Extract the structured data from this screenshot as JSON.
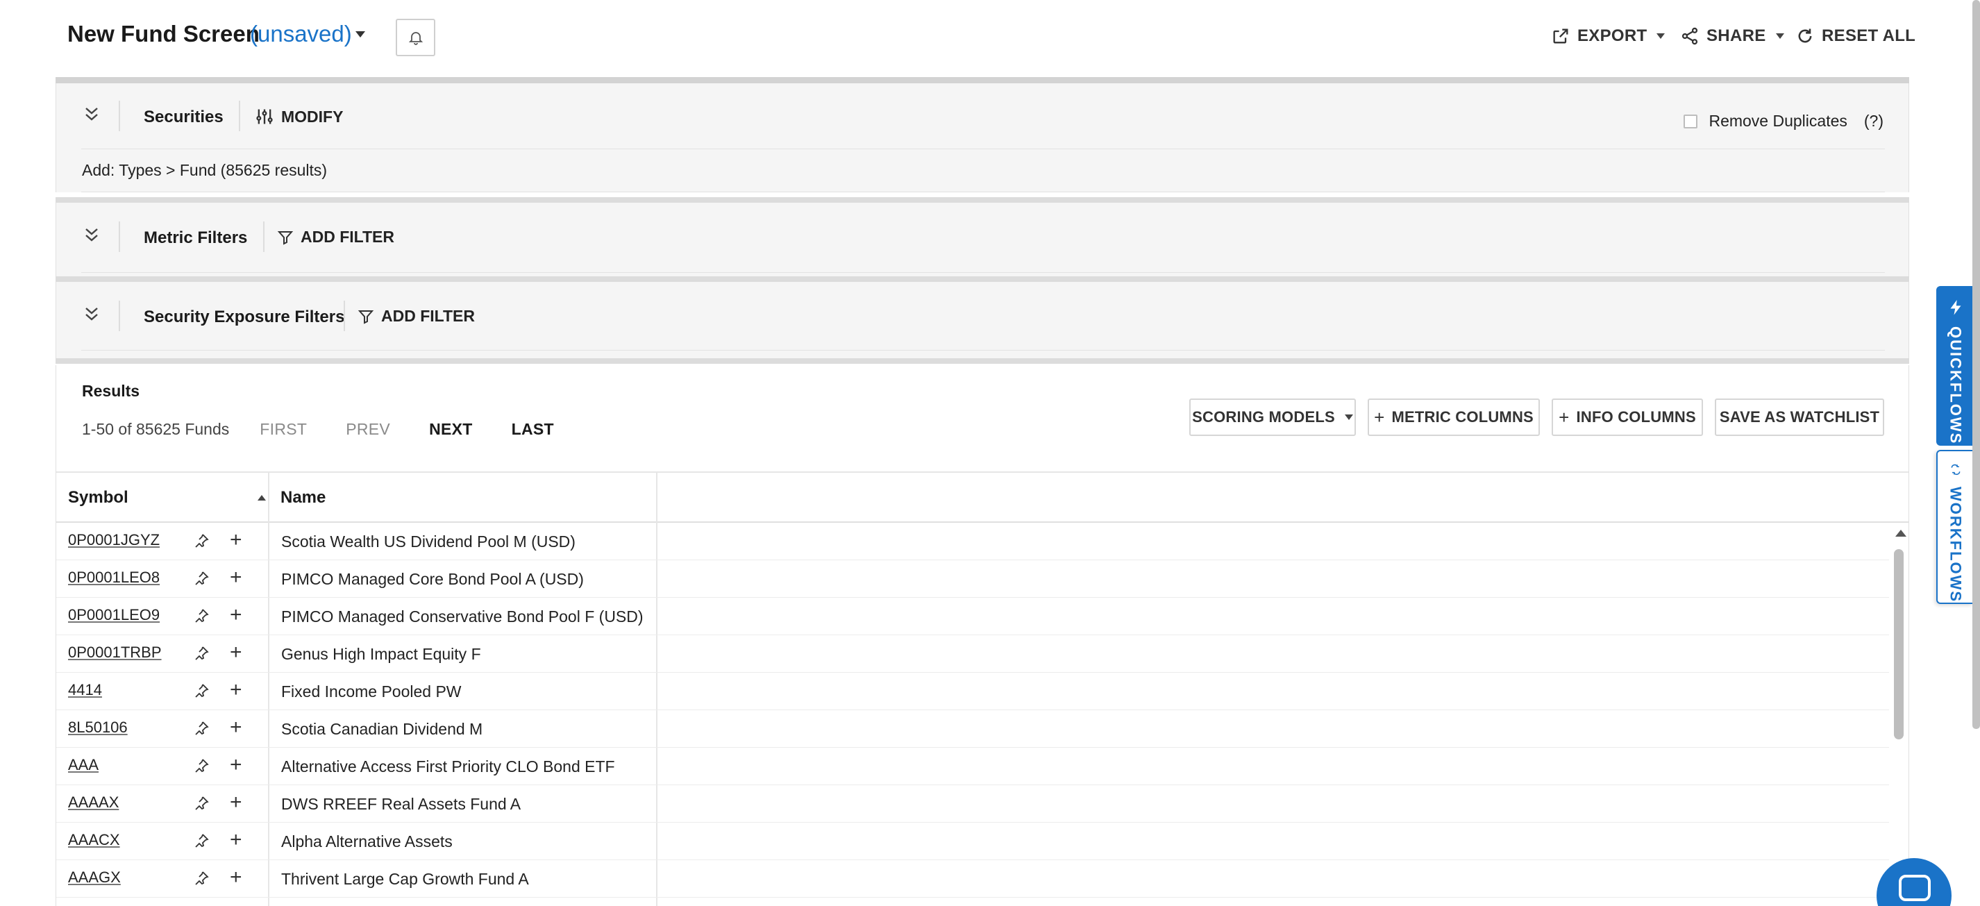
{
  "header": {
    "title": "New Fund Screen",
    "status": "(unsaved)",
    "export_label": "EXPORT",
    "share_label": "SHARE",
    "reset_label": "RESET ALL"
  },
  "securities": {
    "label": "Securities",
    "modify_label": "MODIFY",
    "filter_text": "Add: Types > Fund (85625 results)",
    "remove_duplicates_label": "Remove Duplicates",
    "remove_duplicates_checked": false,
    "help_label": "(?)"
  },
  "metric_filters": {
    "label": "Metric Filters",
    "add_filter_label": "ADD FILTER"
  },
  "exposure_filters": {
    "label": "Security Exposure Filters",
    "add_filter_label": "ADD FILTER"
  },
  "results": {
    "title": "Results",
    "count_text": "1-50 of 85625 Funds",
    "first_label": "FIRST",
    "prev_label": "PREV",
    "next_label": "NEXT",
    "last_label": "LAST",
    "scoring_models_label": "SCORING MODELS",
    "metric_columns_label": "METRIC COLUMNS",
    "info_columns_label": "INFO COLUMNS",
    "save_watchlist_label": "SAVE AS WATCHLIST"
  },
  "table": {
    "columns": [
      "Symbol",
      "Name"
    ],
    "sort": {
      "column": "Symbol",
      "direction": "ascending"
    },
    "rows": [
      {
        "symbol": "0P0001JGYZ",
        "name": "Scotia Wealth US Dividend Pool M (USD)"
      },
      {
        "symbol": "0P0001LEO8",
        "name": "PIMCO Managed Core Bond Pool A (USD)"
      },
      {
        "symbol": "0P0001LEO9",
        "name": "PIMCO Managed Conservative Bond Pool F (USD)"
      },
      {
        "symbol": "0P0001TRBP",
        "name": "Genus High Impact Equity F"
      },
      {
        "symbol": "4414",
        "name": "Fixed Income Pooled PW"
      },
      {
        "symbol": "8L50106",
        "name": "Scotia Canadian Dividend M"
      },
      {
        "symbol": "AAA",
        "name": "Alternative Access First Priority CLO Bond ETF"
      },
      {
        "symbol": "AAAAX",
        "name": "DWS RREEF Real Assets Fund A"
      },
      {
        "symbol": "AAACX",
        "name": "Alpha Alternative Assets"
      },
      {
        "symbol": "AAAGX",
        "name": "Thrivent Large Cap Growth Fund A"
      }
    ]
  },
  "side_tabs": {
    "quickflows_label": "QUICKFLOWS",
    "workflows_label": "WORKFLOWS"
  },
  "colors": {
    "accent": "#1a73c8",
    "panel_bg": "#f5f5f5"
  }
}
